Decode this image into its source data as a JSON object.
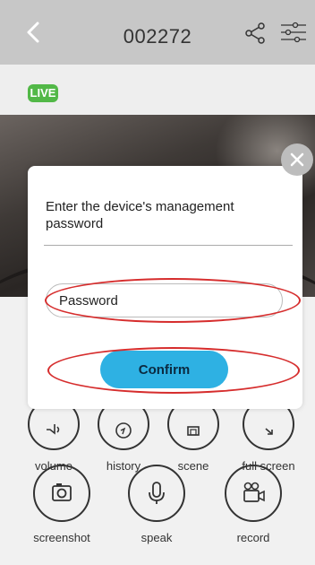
{
  "header": {
    "back_icon": "chevron-left-icon",
    "title": "002272",
    "share_icon": "share-icon",
    "settings_icon": "sliders-icon"
  },
  "live_badge": "LIVE",
  "controls": {
    "row1": [
      {
        "label": "volume",
        "icon": "volume-icon"
      },
      {
        "label": "history",
        "icon": "history-icon"
      },
      {
        "label": "scene",
        "icon": "scene-icon"
      },
      {
        "label": "full screen",
        "icon": "fullscreen-icon"
      }
    ],
    "row2": [
      {
        "label": "screenshot",
        "icon": "camera-icon"
      },
      {
        "label": "speak",
        "icon": "microphone-icon"
      },
      {
        "label": "record",
        "icon": "video-camera-icon"
      }
    ]
  },
  "dialog": {
    "prompt": "Enter the device's management password",
    "password_placeholder": "Password",
    "password_value": "",
    "confirm_label": "Confirm",
    "close_icon": "close-icon"
  },
  "annotation_color": "#d62d2d",
  "colors": {
    "topbar": "#c7c7c7",
    "live_green": "#52b847",
    "confirm_blue": "#2eb1e3"
  }
}
